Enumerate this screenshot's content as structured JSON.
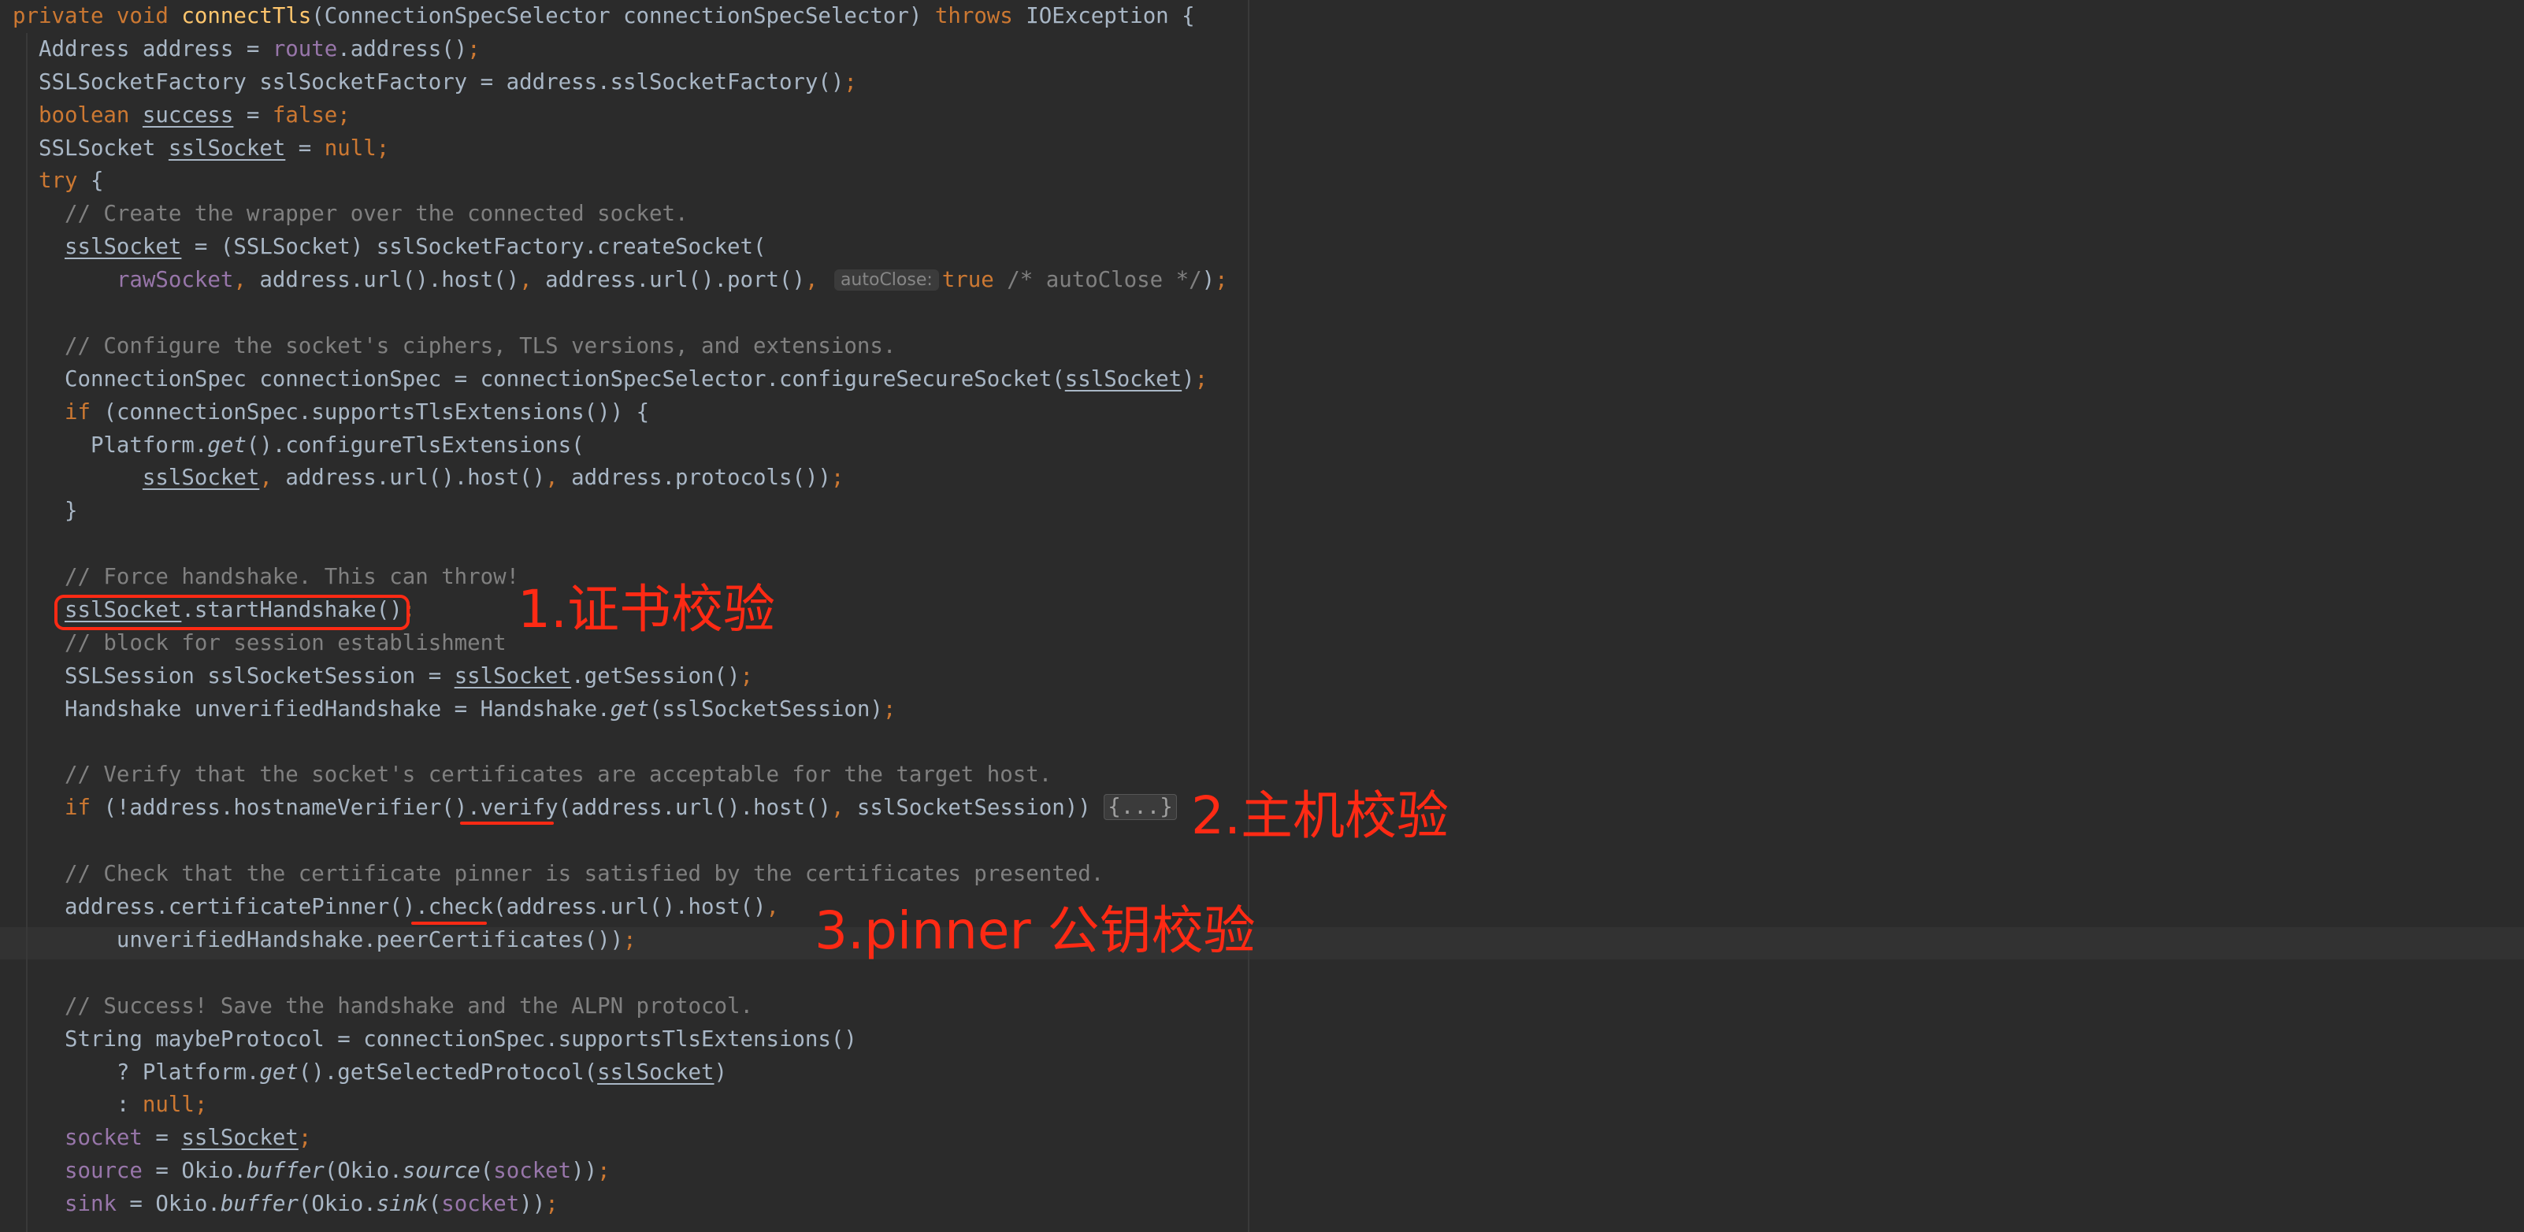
{
  "annotations": {
    "step1": "1.证书校验",
    "step2": "2.主机校验",
    "step3": "3.pinner 公钥校验"
  },
  "colors": {
    "background": "#2b2b2b",
    "keyword": "#cc7832",
    "method_declaration": "#ffc66d",
    "field": "#9876aa",
    "comment": "#808080",
    "default_text": "#a9b7c6",
    "annotation": "#ff2a14"
  },
  "code": {
    "lines": [
      [
        [
          "private void ",
          "kw"
        ],
        [
          "connectTls",
          "fn"
        ],
        [
          "(ConnectionSpecSelector connectionSpecSelector) ",
          ""
        ],
        [
          "throws ",
          "kw"
        ],
        [
          "IOException {",
          ""
        ]
      ],
      [
        [
          "  Address address = ",
          ""
        ],
        [
          "route",
          "fld"
        ],
        [
          ".address()",
          ""
        ],
        [
          ";",
          "kw"
        ]
      ],
      [
        [
          "  SSLSocketFactory sslSocketFactory = address.sslSocketFactory()",
          ""
        ],
        [
          ";",
          "kw"
        ]
      ],
      [
        [
          "  ",
          ""
        ],
        [
          "boolean ",
          "kw"
        ],
        [
          "success",
          "ul"
        ],
        [
          " = ",
          ""
        ],
        [
          "false",
          "kw"
        ],
        [
          ";",
          "kw"
        ]
      ],
      [
        [
          "  SSLSocket ",
          ""
        ],
        [
          "sslSocket",
          "ul"
        ],
        [
          " = ",
          ""
        ],
        [
          "null",
          "kw"
        ],
        [
          ";",
          "kw"
        ]
      ],
      [
        [
          "  ",
          ""
        ],
        [
          "try ",
          "kw"
        ],
        [
          "{",
          ""
        ]
      ],
      [
        [
          "    // Create the wrapper over the connected socket.",
          "cm"
        ]
      ],
      [
        [
          "    ",
          ""
        ],
        [
          "sslSocket",
          "ul"
        ],
        [
          " = (SSLSocket) sslSocketFactory.createSocket(",
          ""
        ]
      ],
      [
        [
          "        ",
          ""
        ],
        [
          "rawSocket",
          "fld"
        ],
        [
          ", ",
          "kw"
        ],
        [
          "address.url().host()",
          ""
        ],
        [
          ", ",
          "kw"
        ],
        [
          "address.url().port()",
          ""
        ],
        [
          ", ",
          "kw"
        ],
        [
          "autoClose:",
          "hint"
        ],
        [
          "true ",
          "kw"
        ],
        [
          "/* autoClose */",
          "cm"
        ],
        [
          ")",
          ""
        ],
        [
          ";",
          "kw"
        ]
      ],
      [
        [
          "",
          ""
        ]
      ],
      [
        [
          "    // Configure the socket's ciphers, TLS versions, and extensions.",
          "cm"
        ]
      ],
      [
        [
          "    ConnectionSpec connectionSpec = connectionSpecSelector.configureSecureSocket(",
          ""
        ],
        [
          "sslSocket",
          "ul"
        ],
        [
          ")",
          ""
        ],
        [
          ";",
          "kw"
        ]
      ],
      [
        [
          "    ",
          ""
        ],
        [
          "if ",
          "kw"
        ],
        [
          "(connectionSpec.supportsTlsExtensions()) {",
          ""
        ]
      ],
      [
        [
          "      Platform.",
          ""
        ],
        [
          "get",
          "it"
        ],
        [
          "().configureTlsExtensions(",
          ""
        ]
      ],
      [
        [
          "          ",
          ""
        ],
        [
          "sslSocket",
          "ul"
        ],
        [
          ", ",
          "kw"
        ],
        [
          "address.url().host()",
          ""
        ],
        [
          ", ",
          "kw"
        ],
        [
          "address.protocols())",
          ""
        ],
        [
          ";",
          "kw"
        ]
      ],
      [
        [
          "    }",
          ""
        ]
      ],
      [
        [
          "",
          ""
        ]
      ],
      [
        [
          "    // Force handshake. This can throw!",
          "cm"
        ]
      ],
      [
        [
          "    ",
          ""
        ],
        [
          "sslSocket",
          "ul"
        ],
        [
          ".startHandshake()",
          ""
        ],
        [
          ";",
          "kw"
        ]
      ],
      [
        [
          "    // block for session establishment",
          "cm"
        ]
      ],
      [
        [
          "    SSLSession sslSocketSession = ",
          ""
        ],
        [
          "sslSocket",
          "ul"
        ],
        [
          ".getSession()",
          ""
        ],
        [
          ";",
          "kw"
        ]
      ],
      [
        [
          "    Handshake unverifiedHandshake = Handshake.",
          ""
        ],
        [
          "get",
          "it"
        ],
        [
          "(sslSocketSession)",
          ""
        ],
        [
          ";",
          "kw"
        ]
      ],
      [
        [
          "",
          ""
        ]
      ],
      [
        [
          "    // Verify that the socket's certificates are acceptable for the target host.",
          "cm"
        ]
      ],
      [
        [
          "    ",
          ""
        ],
        [
          "if ",
          "kw"
        ],
        [
          "(!address.hostnameVerifier().verify(address.url().host()",
          ""
        ],
        [
          ", ",
          "kw"
        ],
        [
          "sslSocketSession)) ",
          ""
        ],
        [
          "{...}",
          "fold"
        ]
      ],
      [
        [
          "",
          ""
        ]
      ],
      [
        [
          "    // Check that the certificate pinner is satisfied by the certificates presented.",
          "cm"
        ]
      ],
      [
        [
          "    address.certificatePinner().check(address.url().host()",
          ""
        ],
        [
          ",",
          "kw"
        ]
      ],
      [
        [
          "        unverifiedHandshake.peerCertificates())",
          ""
        ],
        [
          ";",
          "kw"
        ]
      ],
      [
        [
          "",
          ""
        ]
      ],
      [
        [
          "    // Success! Save the handshake and the ALPN protocol.",
          "cm"
        ]
      ],
      [
        [
          "    String maybeProtocol = connectionSpec.supportsTlsExtensions()",
          ""
        ]
      ],
      [
        [
          "        ? Platform.",
          ""
        ],
        [
          "get",
          "it"
        ],
        [
          "().getSelectedProtocol(",
          ""
        ],
        [
          "sslSocket",
          "ul"
        ],
        [
          ")",
          ""
        ]
      ],
      [
        [
          "        : ",
          ""
        ],
        [
          "null",
          "kw"
        ],
        [
          ";",
          "kw"
        ]
      ],
      [
        [
          "    ",
          ""
        ],
        [
          "socket",
          "fld"
        ],
        [
          " = ",
          ""
        ],
        [
          "sslSocket",
          "ul"
        ],
        [
          ";",
          "kw"
        ]
      ],
      [
        [
          "    ",
          ""
        ],
        [
          "source",
          "fld"
        ],
        [
          " = Okio.",
          ""
        ],
        [
          "buffer",
          "it"
        ],
        [
          "(Okio.",
          ""
        ],
        [
          "source",
          "it"
        ],
        [
          "(",
          ""
        ],
        [
          "socket",
          "fld"
        ],
        [
          "))",
          ""
        ],
        [
          ";",
          "kw"
        ]
      ],
      [
        [
          "    ",
          ""
        ],
        [
          "sink",
          "fld"
        ],
        [
          " = Okio.",
          ""
        ],
        [
          "buffer",
          "it"
        ],
        [
          "(Okio.",
          ""
        ],
        [
          "sink",
          "it"
        ],
        [
          "(",
          ""
        ],
        [
          "socket",
          "fld"
        ],
        [
          "))",
          ""
        ],
        [
          ";",
          "kw"
        ]
      ]
    ]
  }
}
